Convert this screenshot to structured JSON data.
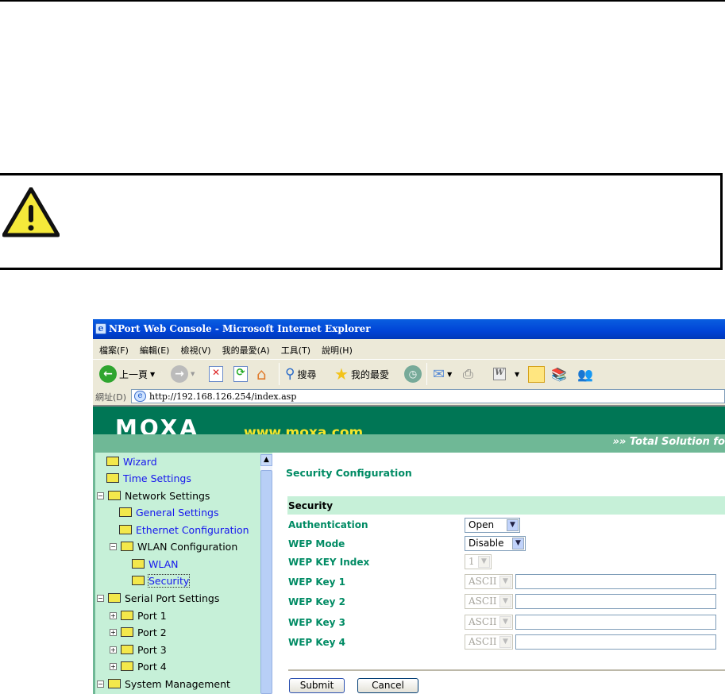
{
  "browser": {
    "title": "NPort Web Console - Microsoft Internet Explorer",
    "menu": [
      "檔案(F)",
      "編輯(E)",
      "檢視(V)",
      "我的最愛(A)",
      "工具(T)",
      "說明(H)"
    ],
    "toolbar": {
      "back": "上一頁",
      "search": "搜尋",
      "favorites": "我的最愛"
    },
    "address_label": "網址(D)",
    "address": "http://192.168.126.254/index.asp"
  },
  "header": {
    "logo": "MOXA",
    "url": "www.moxa.com",
    "tagline": "Total Solution fo"
  },
  "sidebar": {
    "items": [
      {
        "label": "Wizard"
      },
      {
        "label": "Time Settings"
      },
      {
        "label": "Network Settings"
      },
      {
        "label": "General Settings"
      },
      {
        "label": "Ethernet Configuration"
      },
      {
        "label": "WLAN Configuration"
      },
      {
        "label": "WLAN"
      },
      {
        "label": "Security"
      },
      {
        "label": "Serial Port Settings"
      },
      {
        "label": "Port 1"
      },
      {
        "label": "Port 2"
      },
      {
        "label": "Port 3"
      },
      {
        "label": "Port 4"
      },
      {
        "label": "System Management"
      }
    ]
  },
  "content": {
    "title": "Security Configuration",
    "section": "Security",
    "rows": [
      {
        "label": "Authentication",
        "value": "Open"
      },
      {
        "label": "WEP Mode",
        "value": "Disable"
      },
      {
        "label": "WEP KEY Index",
        "value": "1"
      },
      {
        "label": "WEP Key 1",
        "value": "ASCII",
        "key": ""
      },
      {
        "label": "WEP Key 2",
        "value": "ASCII",
        "key": ""
      },
      {
        "label": "WEP Key 3",
        "value": "ASCII",
        "key": ""
      },
      {
        "label": "WEP Key 4",
        "value": "ASCII",
        "key": ""
      }
    ],
    "submit": "Submit",
    "cancel": "Cancel"
  },
  "colors": {
    "moxa_green": "#007655",
    "label_green": "#008b64",
    "sidebar_bg": "#c6f0d8"
  }
}
